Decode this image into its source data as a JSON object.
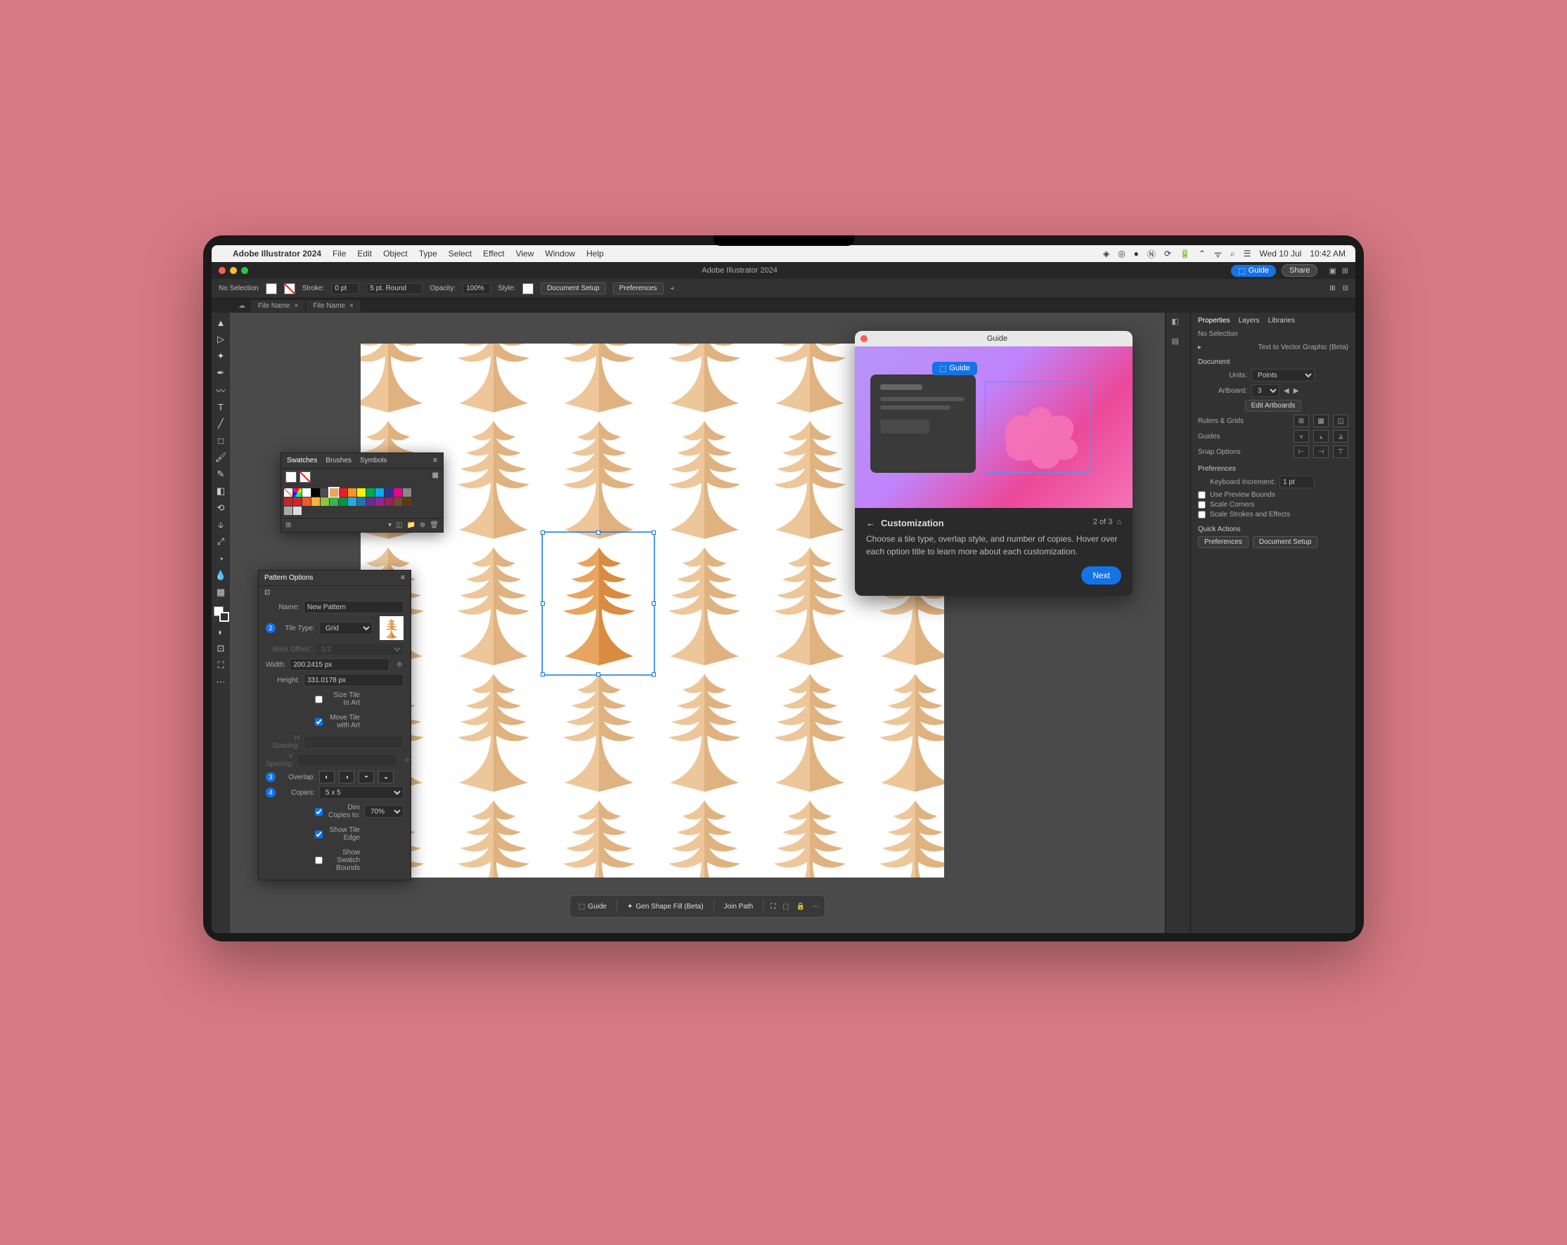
{
  "menubar": {
    "app": "Adobe Illustrator 2024",
    "items": [
      "File",
      "Edit",
      "Object",
      "Type",
      "Select",
      "Effect",
      "View",
      "Window",
      "Help"
    ],
    "date": "Wed 10 Jul",
    "time": "10:42 AM"
  },
  "window": {
    "title": "Adobe Illustrator 2024",
    "guide_btn": "Guide",
    "share_btn": "Share"
  },
  "optbar": {
    "selection_state": "No Selection",
    "stroke_label": "Stroke:",
    "stroke_val": "0 pt",
    "brush_val": "5 pt. Round",
    "opacity_label": "Opacity:",
    "opacity_val": "100%",
    "style_label": "Style:",
    "doc_setup": "Document Setup",
    "prefs": "Preferences"
  },
  "doctabs": {
    "tab1": "File Name",
    "tab2": "File Name"
  },
  "swatches_panel": {
    "tabs": [
      "Swatches",
      "Brushes",
      "Symbols"
    ]
  },
  "pattern_panel": {
    "title": "Pattern Options",
    "name_label": "Name:",
    "name_val": "New Pattern",
    "tile_label": "Tile Type:",
    "tile_val": "Grid",
    "brick_label": "Brick Offset:",
    "brick_val": "1/2",
    "width_label": "Width:",
    "width_val": "200.2415 px",
    "height_label": "Height:",
    "height_val": "331.0178 px",
    "size_tile": "Size Tile to Art",
    "move_tile": "Move Tile with Art",
    "hspacing": "H Spacing:",
    "vspacing": "V Spacing:",
    "overlap_label": "Overlap:",
    "copies_label": "Copies:",
    "copies_val": "5 x 5",
    "dim_label": "Dim Copies to:",
    "dim_val": "70%",
    "show_tile": "Show Tile Edge",
    "show_swatch": "Show Swatch Bounds"
  },
  "guide_popup": {
    "window_title": "Guide",
    "badge": "Guide",
    "heading": "Customization",
    "body": "Choose a tile type, overlap style, and number of copies. Hover over each option title to learn more about each customization.",
    "step": "2 of 3",
    "next": "Next"
  },
  "ctxbar": {
    "guide": "Guide",
    "gen": "Gen Shape Fill (Beta)",
    "join": "Join Path"
  },
  "properties": {
    "tabs": [
      "Properties",
      "Layers",
      "Libraries"
    ],
    "no_sel": "No Selection",
    "t2v": "Text to Vector Graphic (Beta)",
    "doc": "Document",
    "units_label": "Units:",
    "units_val": "Points",
    "artboard_label": "Artboard:",
    "artboard_val": "3",
    "edit_ab": "Edit Artboards",
    "rulers": "Rulers & Grids",
    "guides": "Guides",
    "snap": "Snap Options",
    "prefs": "Preferences",
    "kbd_label": "Keyboard Increment:",
    "kbd_val": "1 pt",
    "preview": "Use Preview Bounds",
    "scale_c": "Scale Corners",
    "scale_s": "Scale Strokes and Effects",
    "quick": "Quick Actions",
    "qa_prefs": "Preferences",
    "qa_doc": "Document Setup"
  }
}
